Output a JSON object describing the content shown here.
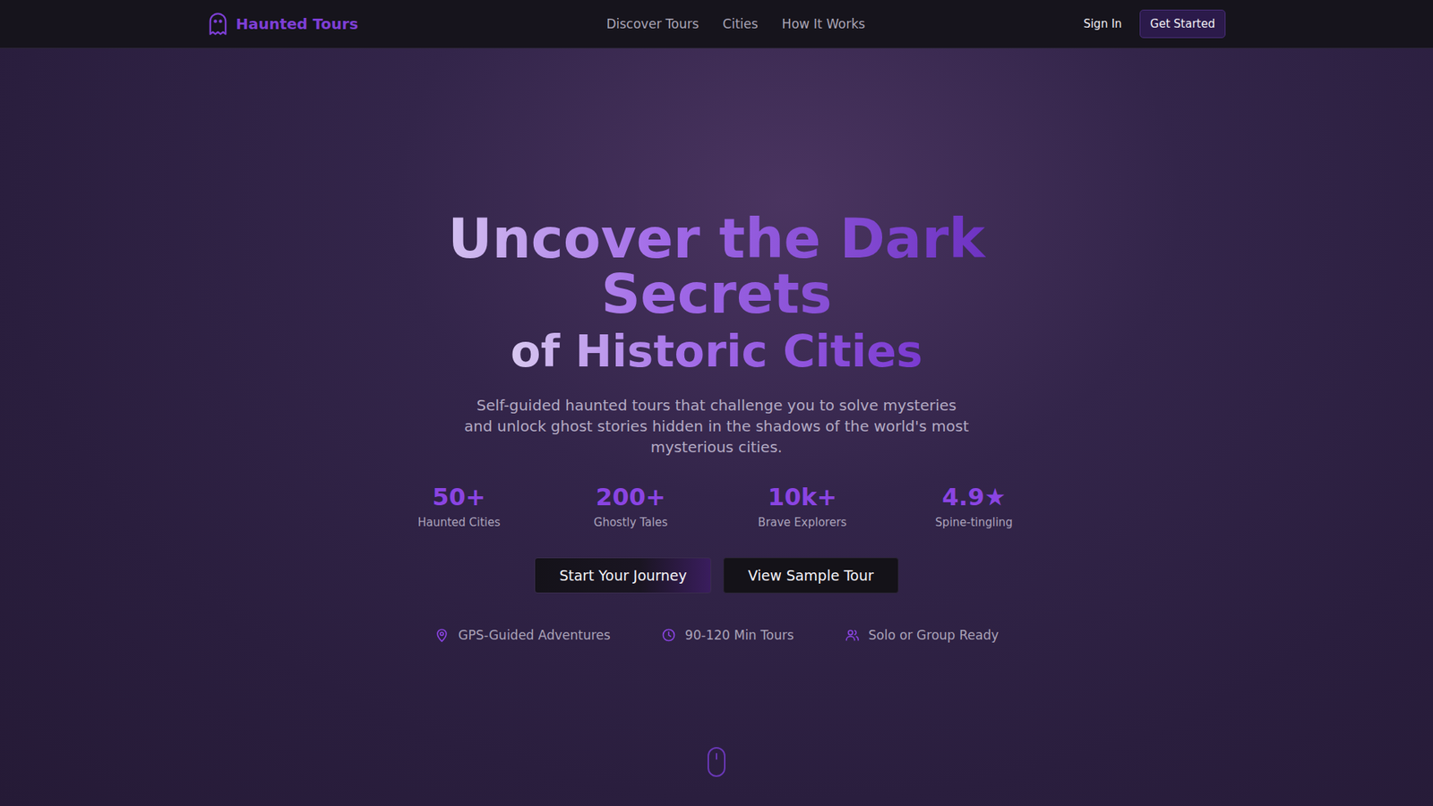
{
  "nav": {
    "logo": "Haunted Tours",
    "links": [
      {
        "label": "Discover Tours"
      },
      {
        "label": "Cities"
      },
      {
        "label": "How It Works"
      }
    ],
    "sign_in": "Sign In",
    "get_started": "Get Started"
  },
  "hero": {
    "title": "Uncover the Dark Secrets",
    "title_line2": "of Historic Cities",
    "subtitle": "Self-guided haunted tours that challenge you to solve mysteries and unlock ghost stories hidden in the shadows of the world's most mysterious cities.",
    "stats": [
      {
        "value": "50+",
        "label": "Haunted Cities"
      },
      {
        "value": "200+",
        "label": "Ghostly Tales"
      },
      {
        "value": "10k+",
        "label": "Brave Explorers"
      },
      {
        "value": "4.9★",
        "label": "Spine-tingling"
      }
    ],
    "buttons": [
      {
        "label": "Start Your Journey",
        "kind": "primary"
      },
      {
        "label": "View Sample Tour",
        "kind": "secondary"
      }
    ],
    "features": [
      {
        "label": "GPS-Guided Adventures",
        "kind": "pin"
      },
      {
        "label": "90-120 Min Tours",
        "kind": "clock"
      },
      {
        "label": "Solo or Group Ready",
        "kind": "users"
      }
    ]
  }
}
